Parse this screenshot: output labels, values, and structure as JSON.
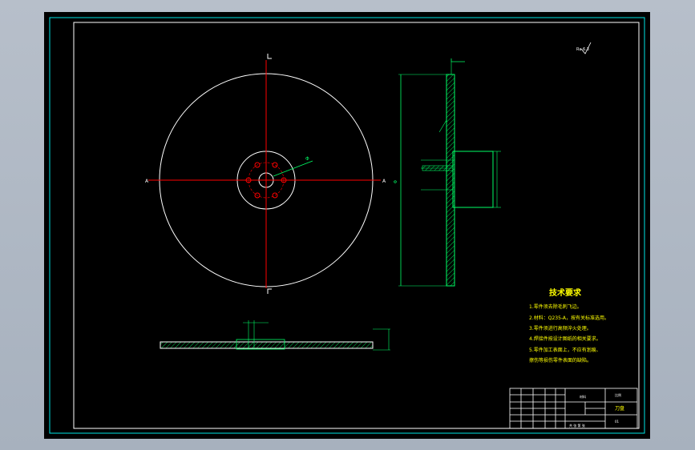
{
  "drawing": {
    "view_labels": {
      "section_mark_top": "⎺",
      "section_mark_side": "⎸",
      "marker_a_left": "A",
      "marker_a_right": "A"
    },
    "tech_requirements": {
      "title": "技术要求",
      "items": [
        "1.零件须去除毛刺飞边。",
        "2.材料：Q235-A，按有关标准选用。",
        "3.零件须进行高频淬火处理。",
        "4.焊接件按设计图纸的相关要求。",
        "5.零件加工表面上，不应有划痕、",
        "擦伤等损伤零件表面的缺陷。"
      ]
    },
    "title_block": {
      "name": "刀盘",
      "scale_label": "比例",
      "material_label": "材料",
      "drawing_no": "01",
      "sheet_label": "共 张  第 张"
    },
    "surface_mark": "Ra 6.3",
    "colors": {
      "frame_outer": "#00e5e5",
      "frame_inner": "#ffffff",
      "center_lines": "#ff0000",
      "geometry": "#ffffff",
      "dimensions": "#00ff66",
      "hatch": "#00ff66",
      "text": "#ffff00"
    }
  }
}
